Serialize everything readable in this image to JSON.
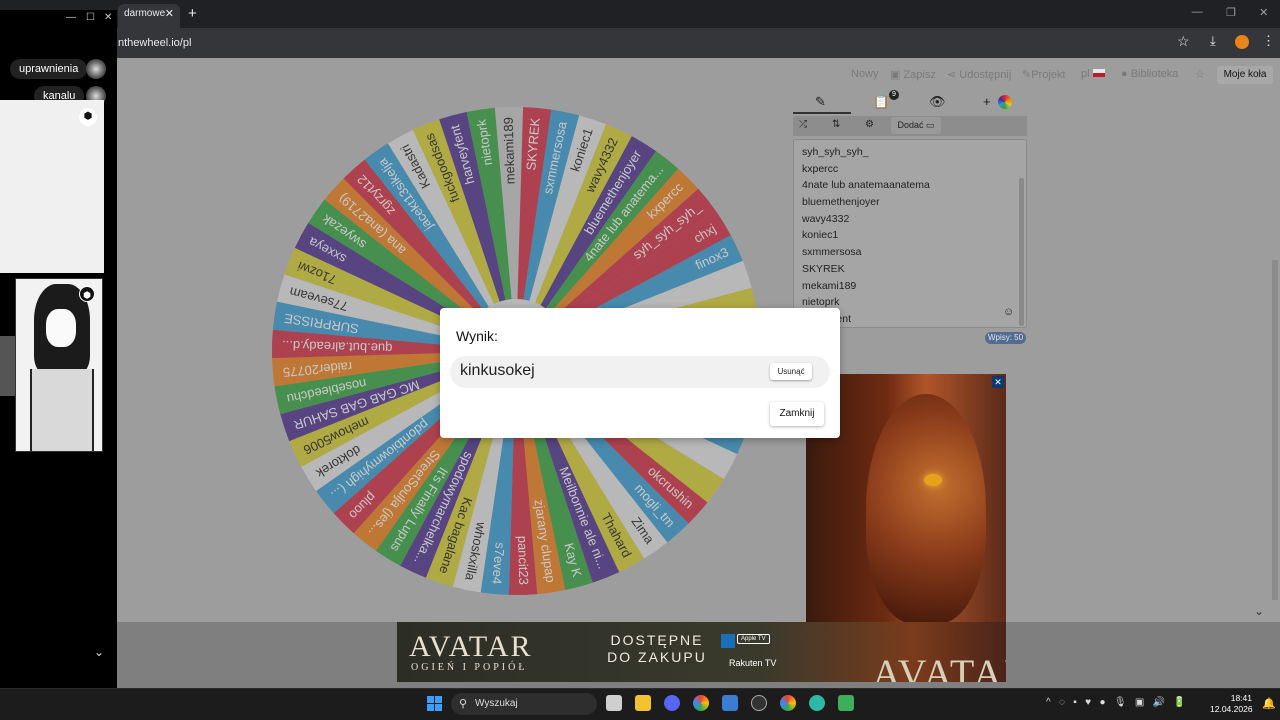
{
  "browser": {
    "tab_title": "darmowe",
    "url": "nthewheel.io/pl"
  },
  "toolbar": {
    "new": "Nowy",
    "save": "Zapisz",
    "share": "Udostępnij",
    "projects": "Projekt",
    "lang": "pl",
    "library": "Biblioteka",
    "my_wheels": "Moje koła"
  },
  "wheel": {
    "segments": [
      {
        "label": "mekami189",
        "color": "#c8c8c8"
      },
      {
        "label": "SKYREK",
        "color": "#d6263d"
      },
      {
        "label": "sxmmersosa",
        "color": "#2f9bd4"
      },
      {
        "label": "koniec1",
        "color": "#e6e6e6"
      },
      {
        "label": "wavy4332",
        "color": "#d8cf2c"
      },
      {
        "label": "bluemethenjoyer",
        "color": "#4a2b8c"
      },
      {
        "label": "4nate lub anatema...",
        "color": "#2ea33b"
      },
      {
        "label": "kxpercc",
        "color": "#f07d12"
      },
      {
        "label": "syh_syh_syh_",
        "color": "#d6263d"
      },
      {
        "label": "chxj",
        "color": "#d6263d"
      },
      {
        "label": "finox3",
        "color": "#2f9bd4"
      },
      {
        "label": "",
        "color": "#e6e6e6"
      },
      {
        "label": "",
        "color": "#d8cf2c"
      },
      {
        "label": "",
        "color": "#4a2b8c"
      },
      {
        "label": "",
        "color": "#2ea33b"
      },
      {
        "label": "",
        "color": "#f07d12"
      },
      {
        "label": "",
        "color": "#d6263d"
      },
      {
        "label": "",
        "color": "#2f9bd4"
      },
      {
        "label": "",
        "color": "#e6e6e6"
      },
      {
        "label": "",
        "color": "#d8cf2c"
      },
      {
        "label": "okcrushin",
        "color": "#d6263d"
      },
      {
        "label": "mogli_tm",
        "color": "#2f9bd4"
      },
      {
        "label": "Zima",
        "color": "#e6e6e6"
      },
      {
        "label": "Thahard",
        "color": "#d8cf2c"
      },
      {
        "label": "Meilbonnie ale ni...",
        "color": "#4a2b8c"
      },
      {
        "label": "Kay K",
        "color": "#2ea33b"
      },
      {
        "label": "zjarany clupap",
        "color": "#f07d12"
      },
      {
        "label": "pancit23",
        "color": "#d6263d"
      },
      {
        "label": "s7eve4",
        "color": "#2f9bd4"
      },
      {
        "label": "whoskxilla",
        "color": "#e6e6e6"
      },
      {
        "label": "Kac bagalane",
        "color": "#d8cf2c"
      },
      {
        "label": "spodowymarchelka...",
        "color": "#4a2b8c"
      },
      {
        "label": "It's Finally Lupus",
        "color": "#2ea33b"
      },
      {
        "label": "StreetSoulja (jes...",
        "color": "#f07d12"
      },
      {
        "label": "pluoo",
        "color": "#d6263d"
      },
      {
        "label": "pdontbiowmyhigh (...",
        "color": "#2f9bd4"
      },
      {
        "label": "doktorek",
        "color": "#e6e6e6"
      },
      {
        "label": "mehow5006",
        "color": "#d8cf2c"
      },
      {
        "label": "MC GAB GAB SAHUR",
        "color": "#4a2b8c"
      },
      {
        "label": "nosebleedchu",
        "color": "#2ea33b"
      },
      {
        "label": "raider20775",
        "color": "#f07d12"
      },
      {
        "label": "que.but.already.d...",
        "color": "#d6263d"
      },
      {
        "label": "SURPRISSE",
        "color": "#2f9bd4"
      },
      {
        "label": "77seveam",
        "color": "#e6e6e6"
      },
      {
        "label": "71ozwi",
        "color": "#d8cf2c"
      },
      {
        "label": "sxxeya",
        "color": "#4a2b8c"
      },
      {
        "label": "swyezak",
        "color": "#2ea33b"
      },
      {
        "label": "ana (ana2719)",
        "color": "#f07d12"
      },
      {
        "label": "zgrzyt12",
        "color": "#d6263d"
      },
      {
        "label": "jacekt13sikelja",
        "color": "#2f9bd4"
      },
      {
        "label": "Kadastri",
        "color": "#e6e6e6"
      },
      {
        "label": "fuckgoodsas",
        "color": "#d8cf2c"
      },
      {
        "label": "harveyfent",
        "color": "#4a2b8c"
      },
      {
        "label": "nietoprk",
        "color": "#2ea33b"
      }
    ]
  },
  "panel": {
    "tabs": [
      "✎",
      "📋",
      "👁",
      "+"
    ],
    "badge": "9",
    "add_label": "Dodać",
    "entries": [
      "syh_syh_syh_",
      "kxpercc",
      "4nate lub anatemaanatema",
      "bluemethenjoyer",
      "wavy4332",
      "koniec1",
      "sxmmersosa",
      "SKYREK",
      "mekami189",
      "nietoprk",
      "harveyfent"
    ],
    "count_label": "Wpisy: 50"
  },
  "modal": {
    "title": "Wynik:",
    "result": "kinkusokej",
    "remove": "Usunąć",
    "close": "Zamknij"
  },
  "ads": {
    "title": "AVATAR",
    "subtitle": "OGIEŃ I POPIÓŁ",
    "available": "DOSTĘPNE DO ZAKUPU",
    "rakuten": "Rakuten TV",
    "apple": "Apple TV",
    "big": "AVATAR"
  },
  "chat": {
    "bubble1": "uprawnienia",
    "bubble2": "kanalu"
  },
  "taskbar": {
    "search": "Wyszukaj",
    "time": "18:41",
    "date": "12.04.2026"
  }
}
